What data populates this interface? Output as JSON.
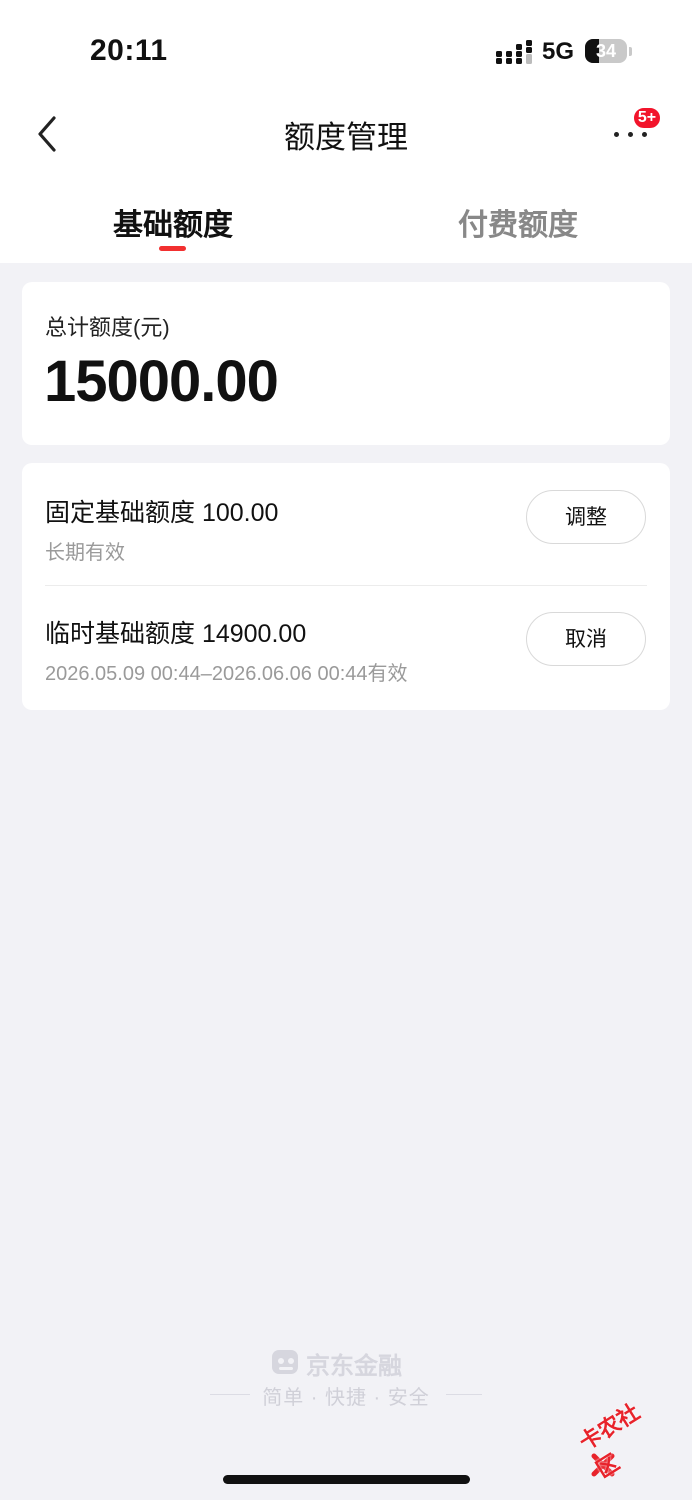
{
  "status_bar": {
    "time": "20:11",
    "network": "5G",
    "battery": "34",
    "battery_level": 0.34
  },
  "nav": {
    "title": "额度管理",
    "badge": "5+"
  },
  "tabs": [
    {
      "label": "基础额度",
      "active": true
    },
    {
      "label": "付费额度",
      "active": false
    }
  ],
  "total": {
    "label": "总计额度(元)",
    "value": "15000.00"
  },
  "items": [
    {
      "title": "固定基础额度 100.00",
      "subtitle": "长期有效",
      "button": "调整"
    },
    {
      "title": "临时基础额度 14900.00",
      "subtitle": "2026.05.09 00:44–2026.06.06 00:44有效",
      "button": "取消"
    }
  ],
  "footer": {
    "brand": "京东金融",
    "slogan": "简单 · 快捷 · 安全"
  },
  "watermark": "卡农社区",
  "colors": {
    "accent": "#f23030",
    "badge": "#f2142b",
    "background": "#f2f2f6"
  }
}
